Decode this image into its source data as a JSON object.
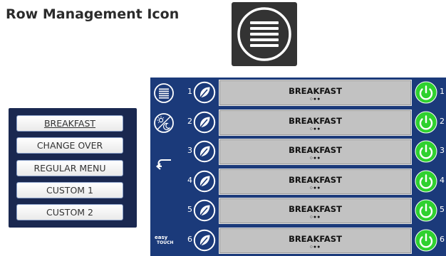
{
  "heading": "Row Management Icon",
  "menu": {
    "items": [
      {
        "label": "BREAKFAST"
      },
      {
        "label": "CHANGE OVER"
      },
      {
        "label": "REGULAR MENU"
      },
      {
        "label": "CUSTOM 1"
      },
      {
        "label": "CUSTOM 2"
      }
    ]
  },
  "brand": {
    "line1": "easy",
    "line2": "TOUCH"
  },
  "rows": [
    {
      "number": "1",
      "label": "BREAKFAST",
      "dots": "○●●",
      "power_number": "1"
    },
    {
      "number": "2",
      "label": "BREAKFAST",
      "dots": "○●●",
      "power_number": "2"
    },
    {
      "number": "3",
      "label": "BREAKFAST",
      "dots": "○●●",
      "power_number": "3"
    },
    {
      "number": "4",
      "label": "BREAKFAST",
      "dots": "○●●",
      "power_number": "4"
    },
    {
      "number": "5",
      "label": "BREAKFAST",
      "dots": "○●●",
      "power_number": "5"
    },
    {
      "number": "6",
      "label": "BREAKFAST",
      "dots": "○●●",
      "power_number": "6"
    }
  ],
  "icons": {
    "row_management": "hamburger-menu-icon",
    "day_night": "day-night-icon",
    "back": "back-arrow-icon",
    "leaf": "leaf-icon",
    "power": "power-icon"
  },
  "colors": {
    "panel_blue": "#1b3a7a",
    "menu_navy": "#1a2850",
    "power_green": "#2fd12f",
    "row_gray": "#c2c2c2"
  }
}
